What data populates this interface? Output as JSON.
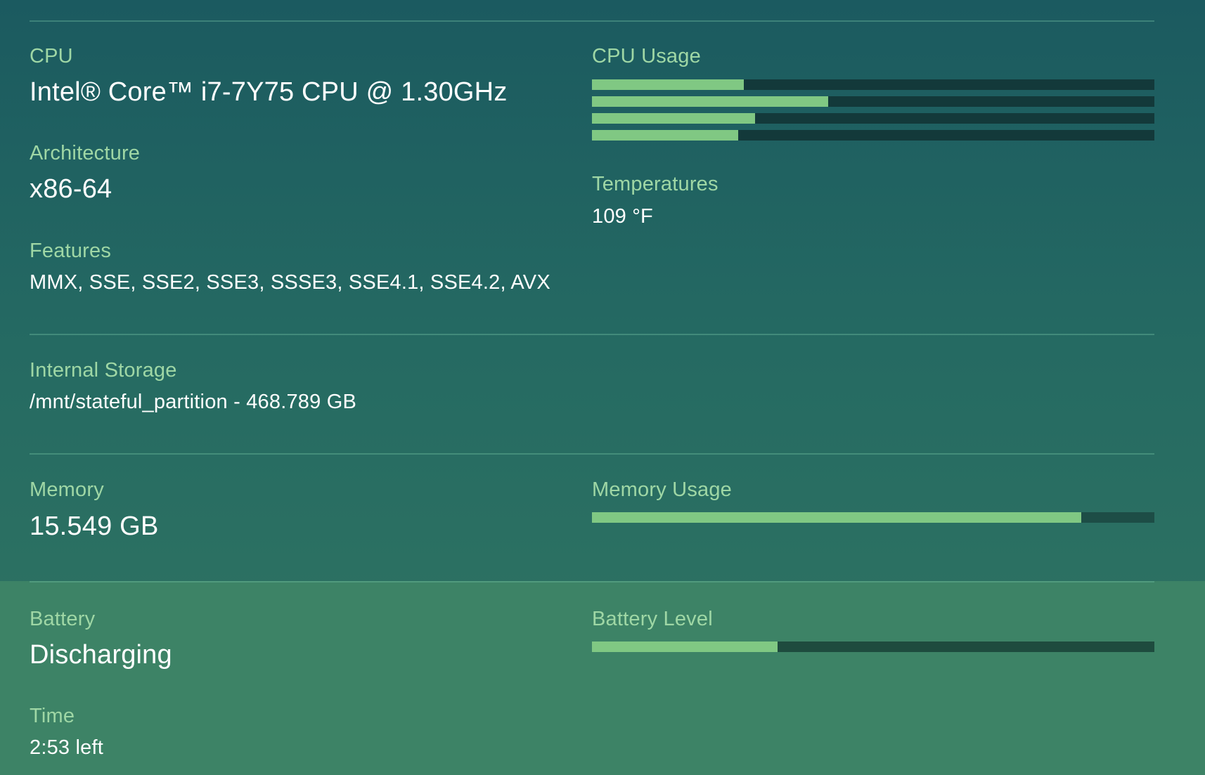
{
  "cpu": {
    "label": "CPU",
    "model": "Intel® Core™ i7-7Y75 CPU @ 1.30GHz",
    "architecture_label": "Architecture",
    "architecture": "x86-64",
    "features_label": "Features",
    "features": "MMX, SSE, SSE2, SSE3, SSSE3, SSE4.1, SSE4.2, AVX",
    "usage_label": "CPU Usage",
    "usage": [
      0.27,
      0.42,
      0.29,
      0.26
    ],
    "temperatures_label": "Temperatures",
    "temperature": "109 °F"
  },
  "storage": {
    "label": "Internal Storage",
    "value": "/mnt/stateful_partition - 468.789 GB"
  },
  "memory": {
    "label": "Memory",
    "value": "15.549 GB",
    "usage_label": "Memory Usage",
    "usage": 0.87
  },
  "battery": {
    "label": "Battery",
    "status": "Discharging",
    "time_label": "Time",
    "time": "2:53 left",
    "level_label": "Battery Level",
    "level": 0.33
  },
  "colors": {
    "accent": "#80c883",
    "label": "#9fd7a5",
    "battery_band": "#3d8366"
  }
}
